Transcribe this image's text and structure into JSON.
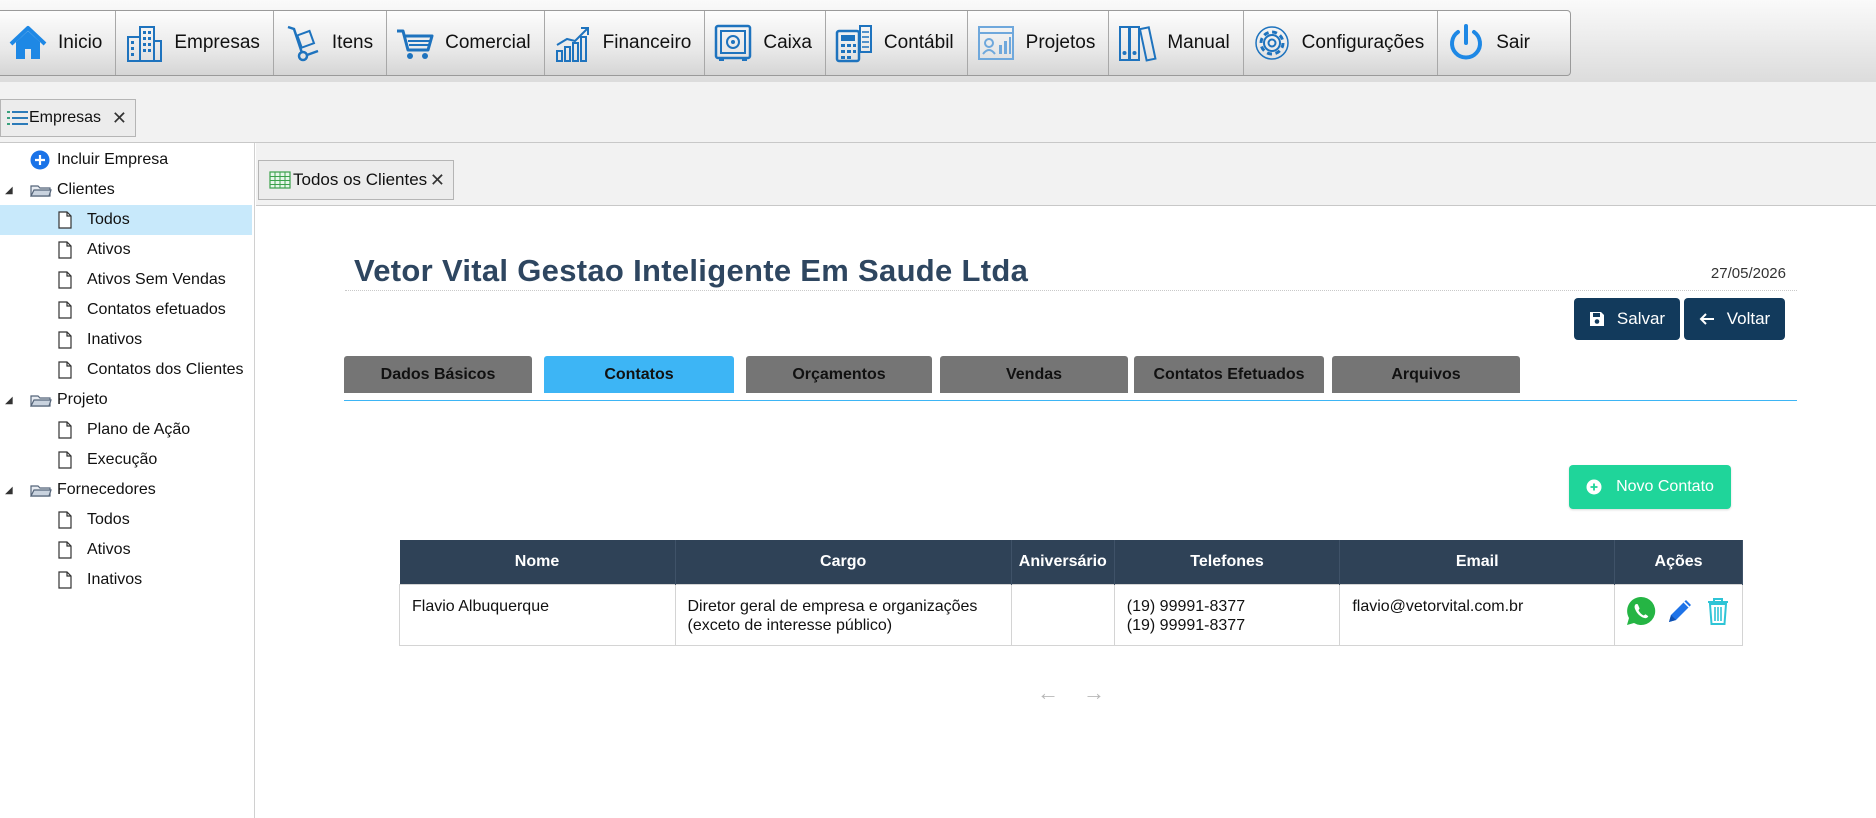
{
  "menu": [
    {
      "label": "Inicio",
      "icon": "home-icon"
    },
    {
      "label": "Empresas",
      "icon": "buildings-icon"
    },
    {
      "label": "Itens",
      "icon": "hand-truck-icon"
    },
    {
      "label": "Comercial",
      "icon": "shopping-cart-icon"
    },
    {
      "label": "Financeiro",
      "icon": "growth-chart-icon"
    },
    {
      "label": "Caixa",
      "icon": "safe-icon"
    },
    {
      "label": "Contábil",
      "icon": "calculator-icon"
    },
    {
      "label": "Projetos",
      "icon": "project-board-icon"
    },
    {
      "label": "Manual",
      "icon": "binders-icon"
    },
    {
      "label": "Configurações",
      "icon": "gear-icon"
    },
    {
      "label": "Sair",
      "icon": "power-icon"
    }
  ],
  "module_tab": {
    "label": "Empresas"
  },
  "sidebar": {
    "include": "Incluir Empresa",
    "clientes": "Clientes",
    "clientes_items": [
      "Todos",
      "Ativos",
      "Ativos Sem Vendas",
      "Contatos efetuados",
      "Inativos",
      "Contatos dos Clientes"
    ],
    "projeto": "Projeto",
    "projeto_items": [
      "Plano de Ação",
      "Execução"
    ],
    "fornecedores": "Fornecedores",
    "fornecedores_items": [
      "Todos",
      "Ativos",
      "Inativos"
    ]
  },
  "inner_tab": {
    "label": "Todos os Clientes"
  },
  "company": {
    "title": "Vetor Vital Gestao Inteligente Em Saude Ltda",
    "date": "27/05/2026"
  },
  "buttons": {
    "save": "Salvar",
    "back": "Voltar",
    "new_contact": "Novo Contato"
  },
  "content_tabs": [
    "Dados Básicos",
    "Contatos",
    "Orçamentos",
    "Vendas",
    "Contatos Efetuados",
    "Arquivos"
  ],
  "active_tab": "Contatos",
  "table": {
    "headers": [
      "Nome",
      "Cargo",
      "Aniversário",
      "Telefones",
      "Email",
      "Ações"
    ],
    "rows": [
      {
        "nome": "Flavio Albuquerque",
        "cargo_line1": "Diretor geral de empresa e organizações",
        "cargo_line2": "(exceto de interesse público)",
        "aniversario": "",
        "telefone1": "(19) 99991-8377",
        "telefone2": "(19) 99991-8377",
        "email": "flavio@vetorvital.com.br"
      }
    ]
  },
  "pager": {
    "prev": "←",
    "next": "→"
  },
  "colors": {
    "navy": "#123a5c",
    "table_header": "#2f4257",
    "tab_active": "#3db5f5",
    "tab_inactive": "#757575",
    "green": "#1fd59a",
    "title": "#2e4660"
  }
}
